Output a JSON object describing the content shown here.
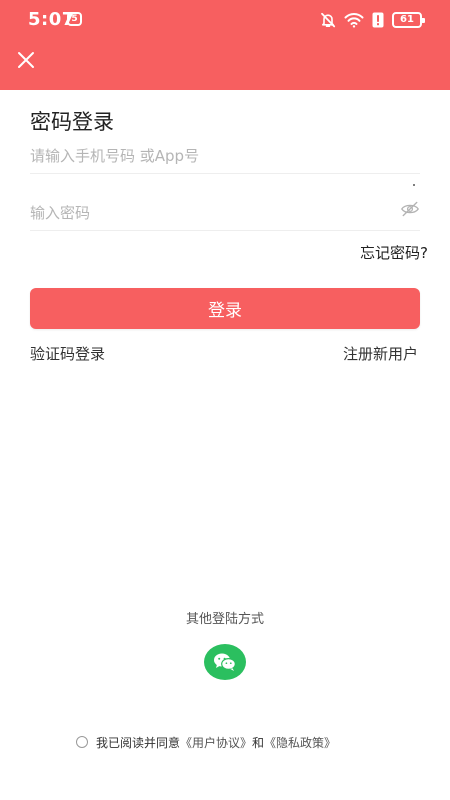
{
  "status_bar": {
    "time": "5:07",
    "badge": "5",
    "battery": "61"
  },
  "header": {
    "close_icon": "close-icon",
    "bg_color": "#f75f60"
  },
  "form": {
    "title": "密码登录",
    "phone_placeholder": "请输入手机号码 或App号",
    "password_placeholder": "输入密码",
    "forgot_label": "忘记密码?",
    "login_label": "登录",
    "sms_login_label": "验证码登录",
    "register_label": "注册新用户"
  },
  "other_login": {
    "title": "其他登陆方式",
    "wechat_icon": "wechat-icon",
    "wechat_color": "#2bbf5f"
  },
  "agreement": {
    "prefix": "我已阅读并同意",
    "user_agreement": "《用户协议》",
    "and": "和",
    "privacy_policy": "《隐私政策》"
  }
}
